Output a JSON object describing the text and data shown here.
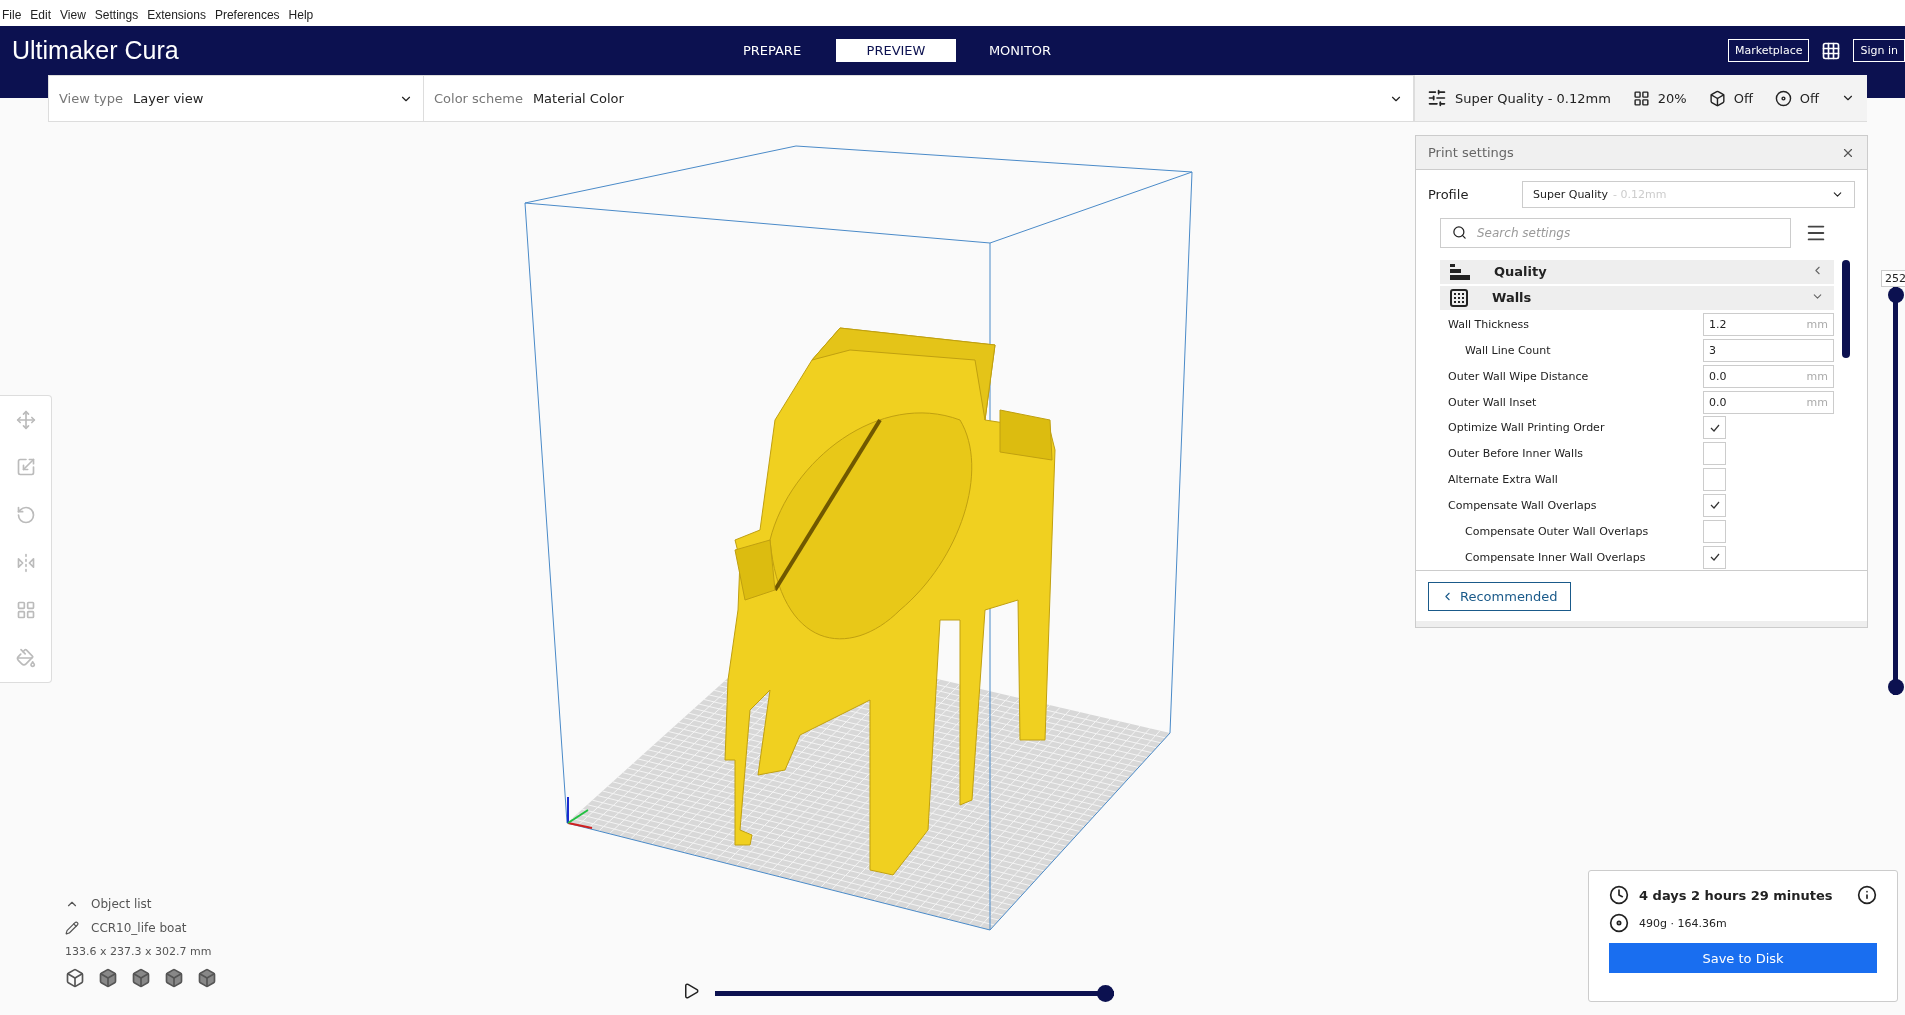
{
  "menu_bar": [
    "File",
    "Edit",
    "View",
    "Settings",
    "Extensions",
    "Preferences",
    "Help"
  ],
  "app_title": "Ultimaker Cura",
  "stages": [
    {
      "label": "PREPARE",
      "selected": false
    },
    {
      "label": "PREVIEW",
      "selected": true
    },
    {
      "label": "MONITOR",
      "selected": false
    }
  ],
  "header_buttons": {
    "marketplace": "Marketplace",
    "sign_in": "Sign in"
  },
  "view_type": {
    "label": "View type",
    "value": "Layer view"
  },
  "color_scheme": {
    "label": "Color scheme",
    "value": "Material Color"
  },
  "print_setup": {
    "profile": "Super Quality - 0.12mm",
    "infill": "20%",
    "support": "Off",
    "adhesion": "Off"
  },
  "print_settings": {
    "title": "Print settings",
    "profile_label": "Profile",
    "profile_name": "Super Quality",
    "profile_detail": "- 0.12mm",
    "search_placeholder": "Search settings",
    "categories": [
      {
        "name": "Quality",
        "expanded": false
      },
      {
        "name": "Walls",
        "expanded": true,
        "settings": [
          {
            "kind": "number",
            "label": "Wall Thickness",
            "value": "1.2",
            "unit": "mm",
            "children": [
              {
                "kind": "number",
                "label": "Wall Line Count",
                "value": "3"
              }
            ]
          },
          {
            "kind": "number",
            "label": "Outer Wall Wipe Distance",
            "value": "0.0",
            "unit": "mm"
          },
          {
            "kind": "number",
            "label": "Outer Wall Inset",
            "value": "0.0",
            "unit": "mm"
          },
          {
            "kind": "checkbox",
            "label": "Optimize Wall Printing Order",
            "checked": true
          },
          {
            "kind": "checkbox",
            "label": "Outer Before Inner Walls",
            "checked": false
          },
          {
            "kind": "checkbox",
            "label": "Alternate Extra Wall",
            "checked": false
          },
          {
            "kind": "checkbox",
            "label": "Compensate Wall Overlaps",
            "checked": true,
            "children": [
              {
                "kind": "checkbox",
                "label": "Compensate Outer Wall Overlaps",
                "checked": false
              },
              {
                "kind": "checkbox",
                "label": "Compensate Inner Wall Overlaps",
                "checked": true
              }
            ]
          }
        ]
      }
    ],
    "footer_button": "Recommended"
  },
  "layer_slider": {
    "reading": "252",
    "level": 1
  },
  "object_list": {
    "title": "Object list",
    "object_name": "CCR10_life boat",
    "dimensions": "133.6 x 237.3 x 302.7 mm"
  },
  "playback": {
    "level": 1
  },
  "job": {
    "time": "4 days 2 hours 29 minutes",
    "material": "490g · 164.36m",
    "button": "Save to Disk"
  }
}
